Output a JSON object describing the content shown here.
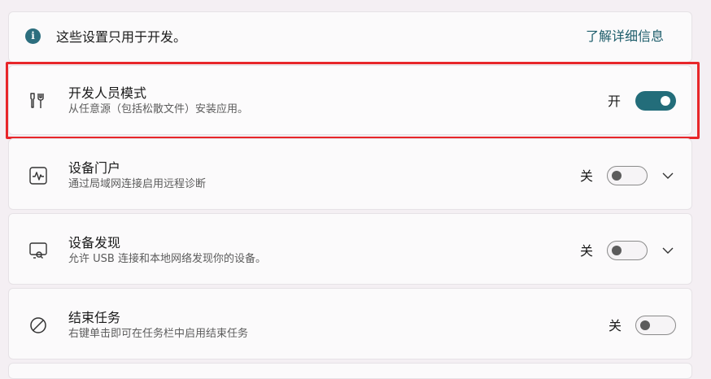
{
  "info": {
    "text": "这些设置只用于开发。",
    "link": "了解详细信息",
    "icon": "info-icon"
  },
  "settings": [
    {
      "title": "开发人员模式",
      "subtitle": "从任意源（包括松散文件）安装应用。",
      "state_label": "开",
      "enabled": true,
      "icon": "developer-tools-icon",
      "expandable": false
    },
    {
      "title": "设备门户",
      "subtitle": "通过局域网连接启用远程诊断",
      "state_label": "关",
      "enabled": false,
      "icon": "device-portal-icon",
      "expandable": true
    },
    {
      "title": "设备发现",
      "subtitle": "允许 USB 连接和本地网络发现你的设备。",
      "state_label": "关",
      "enabled": false,
      "icon": "device-discovery-icon",
      "expandable": true
    },
    {
      "title": "结束任务",
      "subtitle": "右键单击即可在任务栏中启用结束任务",
      "state_label": "关",
      "enabled": false,
      "icon": "end-task-icon",
      "expandable": false
    }
  ],
  "colors": {
    "accent": "#236d7a",
    "link": "#1d5d6b",
    "highlight": "#e8262a"
  }
}
